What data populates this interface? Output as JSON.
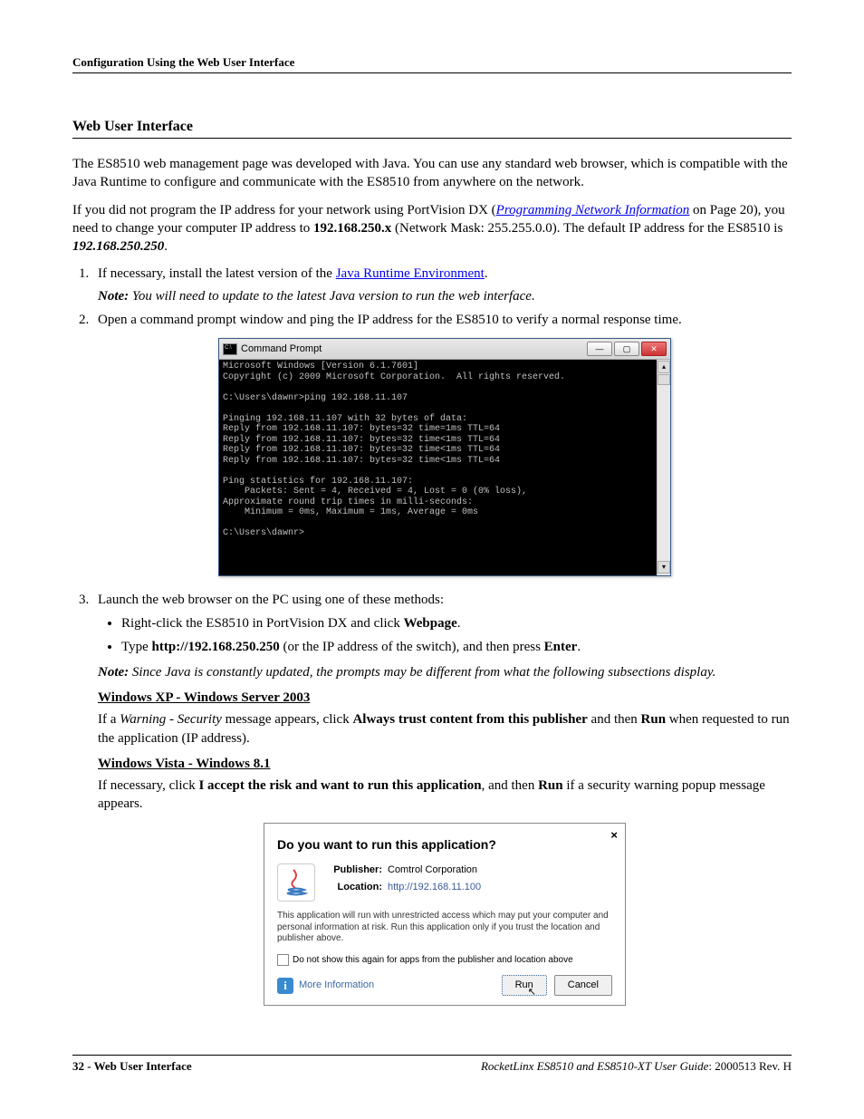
{
  "header": "Configuration Using the Web User Interface",
  "section_title": "Web User Interface",
  "para1": "The ES8510 web management page was developed with Java. You can use any standard web browser, which is compatible with the Java Runtime to configure and communicate with the ES8510 from anywhere on the network.",
  "para2a": "If you did not program the IP address for your network using PortVision DX (",
  "link_prog": "Programming Network Information",
  "para2b": " on Page 20), you need to change your computer IP address to ",
  "ip_net": "192.168.250.x",
  "para2c": " (Network Mask: 255.255.0.0). The default IP address for the ES8510 is ",
  "default_ip": "192.168.250.250",
  "para2d": ".",
  "li1a": "If necessary, install the latest version of the ",
  "link_java": "Java Runtime Environment",
  "li1b": ".",
  "note1_label": "Note:",
  "note1_text": "You will need to update to the latest Java version to run the web interface.",
  "li2": "Open a command prompt window and ping the IP address for the ES8510 to verify a normal response time.",
  "cmd": {
    "title": "Command Prompt",
    "lines": "Microsoft Windows [Version 6.1.7601]\nCopyright (c) 2009 Microsoft Corporation.  All rights reserved.\n\nC:\\Users\\dawnr>ping 192.168.11.107\n\nPinging 192.168.11.107 with 32 bytes of data:\nReply from 192.168.11.107: bytes=32 time=1ms TTL=64\nReply from 192.168.11.107: bytes=32 time<1ms TTL=64\nReply from 192.168.11.107: bytes=32 time<1ms TTL=64\nReply from 192.168.11.107: bytes=32 time<1ms TTL=64\n\nPing statistics for 192.168.11.107:\n    Packets: Sent = 4, Received = 4, Lost = 0 (0% loss),\nApproximate round trip times in milli-seconds:\n    Minimum = 0ms, Maximum = 1ms, Average = 0ms\n\nC:\\Users\\dawnr>"
  },
  "li3": "Launch the web browser on the PC using one of these methods:",
  "b1a": "Right-click the ES8510 in PortVision DX and click ",
  "b1b": "Webpage",
  "b1c": ".",
  "b2a": "Type ",
  "b2b": "http://192.168.250.250",
  "b2c": " (or the IP address of the switch), and then press ",
  "b2d": "Enter",
  "b2e": ".",
  "note2_label": "Note:",
  "note2_text": "Since Java is constantly updated, the prompts may be different from what the following subsections display.",
  "sub1_title": "Windows XP - Windows Server 2003",
  "sub1a": "If a ",
  "sub1b": "Warning - Security",
  "sub1c": " message appears, click ",
  "sub1d": "Always trust content from this publisher",
  "sub1e": " and then ",
  "sub1f": "Run",
  "sub1g": " when requested to run the application (IP address).",
  "sub2_title": "Windows Vista - Windows 8.1",
  "sub2a": "If necessary, click ",
  "sub2b": "I accept the risk and want to run this application",
  "sub2c": ", and then ",
  "sub2d": "Run",
  "sub2e": " if a security warning popup message appears.",
  "java": {
    "title": "Do you want to run this application?",
    "publisher_label": "Publisher:",
    "publisher": "Comtrol Corporation",
    "location_label": "Location:",
    "location": "http://192.168.11.100",
    "warn": "This application will run with unrestricted access which may put your computer and personal information at risk. Run this application only if you trust the location and publisher above.",
    "checkbox": "Do not show this again for apps from the publisher and location above",
    "more_info": "More Information",
    "run": "Run",
    "cancel": "Cancel"
  },
  "footer": {
    "left": "32 - Web User Interface",
    "right_italic": "RocketLinx ES8510  and ES8510-XT User Guide",
    "right_plain": ": 2000513 Rev. H"
  }
}
